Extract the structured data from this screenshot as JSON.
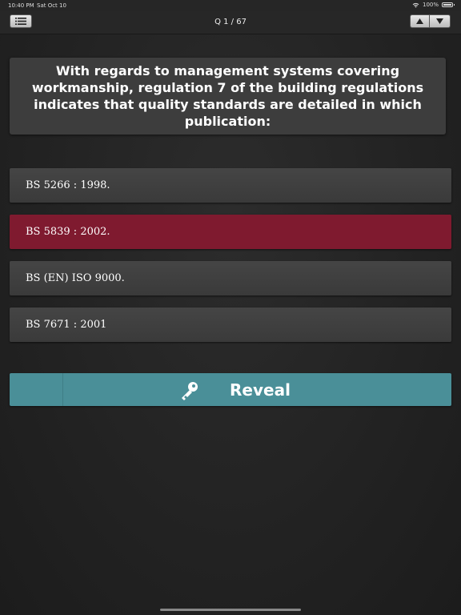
{
  "status_bar": {
    "time": "10:40 PM",
    "date": "Sat Oct 10",
    "battery": "100%",
    "battery_level": 1.0
  },
  "nav": {
    "counter": "Q 1 / 67"
  },
  "question": {
    "text": "With regards to management systems covering workmanship, regulation 7 of the building regulations indicates that quality standards are detailed in which publication:"
  },
  "answers": [
    {
      "label": "BS 5266 : 1998.",
      "selected": false
    },
    {
      "label": "BS 5839 : 2002.",
      "selected": true
    },
    {
      "label": "BS (EN) ISO 9000.",
      "selected": false
    },
    {
      "label": "BS 7671 : 2001",
      "selected": false
    }
  ],
  "reveal": {
    "label": "Reveal"
  },
  "colors": {
    "selected_answer": "#7f1a2f",
    "reveal_button": "#4a8f98",
    "background": "#232323"
  },
  "icons": {
    "menu": "list-icon",
    "up": "arrow-up-icon",
    "down": "arrow-down-icon",
    "reveal": "key-icon",
    "wifi": "wifi-icon",
    "battery": "battery-icon"
  }
}
